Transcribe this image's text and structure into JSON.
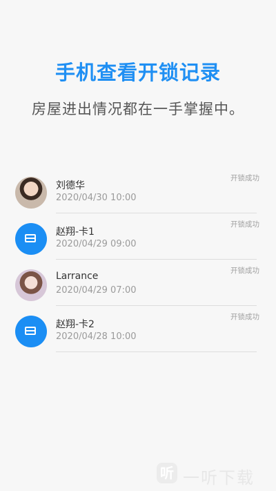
{
  "promo": {
    "headline": "手机查看开锁记录",
    "subline": "房屋进出情况都在一手掌握中。"
  },
  "records": [
    {
      "name": "刘德华",
      "time": "2020/04/30 10:00",
      "status": "开锁成功",
      "avatar": "person-avatar"
    },
    {
      "name": "赵翔-卡1",
      "time": "2020/04/29 09:00",
      "status": "开锁成功",
      "avatar": "card-icon"
    },
    {
      "name": "Larrance",
      "time": "2020/04/29 07:00",
      "status": "开锁成功",
      "avatar": "person-avatar"
    },
    {
      "name": "赵翔-卡2",
      "time": "2020/04/28 10:00",
      "status": "开锁成功",
      "avatar": "card-icon"
    }
  ],
  "watermark": {
    "icon_glyph": "听",
    "text": "一听下载"
  },
  "colors": {
    "accent": "#1f8ff3",
    "background": "#f7f7f7",
    "card_icon": "#1b8ef4"
  }
}
